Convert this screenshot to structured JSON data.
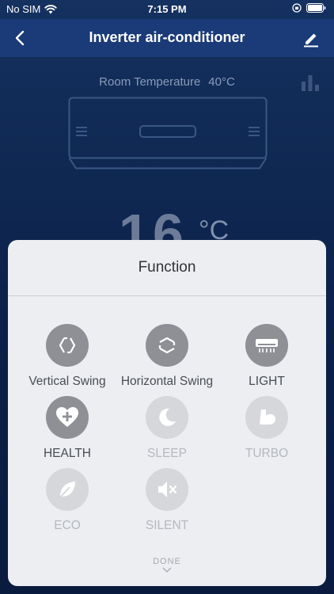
{
  "status_bar": {
    "carrier": "No SIM",
    "time": "7:15 PM",
    "icons": [
      "wifi-icon",
      "orientation-lock-icon",
      "battery-icon"
    ]
  },
  "nav": {
    "title": "Inverter air-conditioner",
    "back_icon": "chevron-left-icon",
    "edit_icon": "pencil-icon"
  },
  "room": {
    "label": "Room Temperature",
    "value": "40°C"
  },
  "set_temperature": {
    "value": "16",
    "unit": "°C"
  },
  "function_sheet": {
    "title": "Function",
    "done_label": "DONE",
    "items": [
      {
        "label": "Vertical Swing",
        "icon": "vertical-swing-icon",
        "enabled": true
      },
      {
        "label": "Horizontal Swing",
        "icon": "horizontal-swing-icon",
        "enabled": true
      },
      {
        "label": "LIGHT",
        "icon": "light-icon",
        "enabled": true
      },
      {
        "label": "HEALTH",
        "icon": "health-icon",
        "enabled": true
      },
      {
        "label": "SLEEP",
        "icon": "sleep-icon",
        "enabled": false
      },
      {
        "label": "TURBO",
        "icon": "turbo-icon",
        "enabled": false
      },
      {
        "label": "ECO",
        "icon": "eco-icon",
        "enabled": false
      },
      {
        "label": "SILENT",
        "icon": "silent-icon",
        "enabled": false
      }
    ]
  },
  "colors": {
    "nav_bar": "#1a3a78",
    "background": "#0f2852",
    "sheet": "#eceef2",
    "active_circle": "#8e9096",
    "disabled_circle": "#d5d7db"
  }
}
